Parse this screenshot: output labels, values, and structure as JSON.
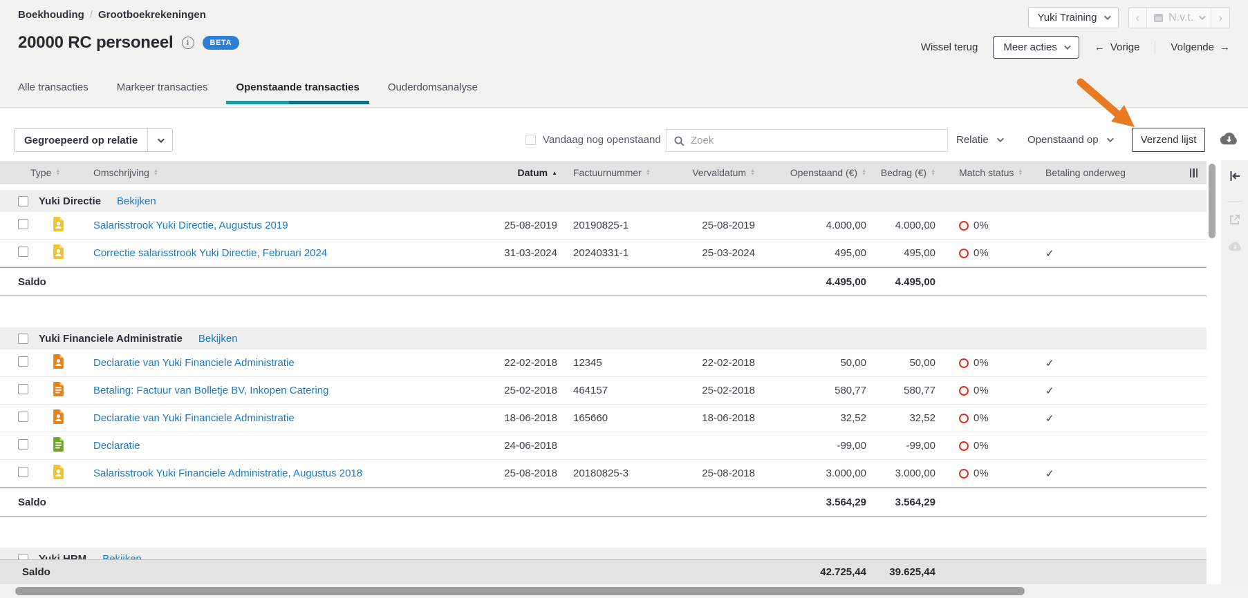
{
  "breadcrumb": {
    "items": [
      "Boekhouding",
      "Grootboekrekeningen"
    ],
    "separator": "/"
  },
  "header": {
    "title": "20000 RC personeel",
    "beta_label": "BETA"
  },
  "topbar": {
    "administration_name": "Yuki Training",
    "period_label": "N.v.t.",
    "wissel_terug": "Wissel terug",
    "meer_acties": "Meer acties",
    "vorige": "Vorige",
    "volgende": "Volgende"
  },
  "tabs": [
    {
      "label": "Alle transacties",
      "active": false
    },
    {
      "label": "Markeer transacties",
      "active": false
    },
    {
      "label": "Openstaande transacties",
      "active": true
    },
    {
      "label": "Ouderdomsanalyse",
      "active": false
    }
  ],
  "filterbar": {
    "group_select_label": "Gegroepeerd op relatie",
    "today_checkbox_label": "Vandaag nog openstaand",
    "search_placeholder": "Zoek",
    "relatie_label": "Relatie",
    "openstaand_op_label": "Openstaand op",
    "verzend_lijst_label": "Verzend lijst"
  },
  "table": {
    "columns": [
      "Type",
      "Omschrijving",
      "Datum",
      "Factuurnummer",
      "Vervaldatum",
      "Openstaand (€)",
      "Bedrag (€)",
      "Match status",
      "Betaling onderweg"
    ],
    "sorted_column": "Datum",
    "groups": [
      {
        "name": "Yuki Directie",
        "view_link": "Bekijken",
        "saldo_label": "Saldo",
        "saldo": {
          "openstaand": "4.495,00",
          "bedrag": "4.495,00"
        },
        "rows": [
          {
            "icon": {
              "name": "salarisstrook-doc-icon",
              "color": "#f0c330",
              "glyph": "person"
            },
            "omschrijving": "Salarisstrook Yuki Directie, Augustus 2019",
            "datum": "25-08-2019",
            "factuurnummer": "20190825-1",
            "vervaldatum": "25-08-2019",
            "openstaand": "4.000,00",
            "bedrag": "4.000,00",
            "match_status": "0%",
            "betaling_onderweg": false
          },
          {
            "icon": {
              "name": "salarisstrook-doc-icon",
              "color": "#f0c330",
              "glyph": "person"
            },
            "omschrijving": "Correctie salarisstrook Yuki Directie, Februari 2024",
            "datum": "31-03-2024",
            "factuurnummer": "20240331-1",
            "vervaldatum": "25-03-2024",
            "openstaand": "495,00",
            "bedrag": "495,00",
            "match_status": "0%",
            "betaling_onderweg": true
          }
        ]
      },
      {
        "name": "Yuki Financiele Administratie",
        "view_link": "Bekijken",
        "saldo_label": "Saldo",
        "saldo": {
          "openstaand": "3.564,29",
          "bedrag": "3.564,29"
        },
        "rows": [
          {
            "icon": {
              "name": "declaratie-doc-icon",
              "color": "#ee7f11",
              "glyph": "person"
            },
            "omschrijving": "Declaratie van Yuki Financiele Administratie",
            "datum": "22-02-2018",
            "factuurnummer": "12345",
            "vervaldatum": "22-02-2018",
            "openstaand": "50,00",
            "bedrag": "50,00",
            "match_status": "0%",
            "betaling_onderweg": true
          },
          {
            "icon": {
              "name": "factuur-doc-icon",
              "color": "#ee7f11",
              "glyph": "lines"
            },
            "omschrijving": "Betaling: Factuur van Bolletje BV, Inkopen Catering",
            "datum": "25-02-2018",
            "factuurnummer": "464157",
            "vervaldatum": "25-02-2018",
            "openstaand": "580,77",
            "bedrag": "580,77",
            "match_status": "0%",
            "betaling_onderweg": true
          },
          {
            "icon": {
              "name": "declaratie-doc-icon",
              "color": "#ee7f11",
              "glyph": "person"
            },
            "omschrijving": "Declaratie van Yuki Financiele Administratie",
            "datum": "18-06-2018",
            "factuurnummer": "165660",
            "vervaldatum": "18-06-2018",
            "openstaand": "32,52",
            "bedrag": "32,52",
            "match_status": "0%",
            "betaling_onderweg": true
          },
          {
            "icon": {
              "name": "declaratie-doc-icon",
              "color": "#6fa81f",
              "glyph": "lines"
            },
            "omschrijving": "Declaratie",
            "datum": "24-06-2018",
            "factuurnummer": "",
            "vervaldatum": "",
            "openstaand": "-99,00",
            "bedrag": "-99,00",
            "match_status": "0%",
            "betaling_onderweg": false
          },
          {
            "icon": {
              "name": "salarisstrook-doc-icon",
              "color": "#f0c330",
              "glyph": "person"
            },
            "omschrijving": "Salarisstrook Yuki Financiele Administratie, Augustus 2018",
            "datum": "25-08-2018",
            "factuurnummer": "20180825-3",
            "vervaldatum": "25-08-2018",
            "openstaand": "3.000,00",
            "bedrag": "3.000,00",
            "match_status": "0%",
            "betaling_onderweg": true
          }
        ]
      },
      {
        "name": "Yuki HRM",
        "view_link": "Bekijken",
        "saldo_label": "Saldo",
        "saldo": null,
        "rows": []
      }
    ],
    "total": {
      "label": "Saldo",
      "openstaand": "42.725,44",
      "bedrag": "39.625,44"
    }
  },
  "colors": {
    "link_blue": "#1b79c4",
    "beta_badge_blue": "#2e7ed5",
    "active_tab_teal": "#1f96a7",
    "match_ring_red": "#e0301e",
    "annotation_arrow_orange": "#e87a24"
  },
  "annotation": {
    "type": "arrow",
    "target": "Verzend lijst",
    "color": "#e87a24"
  }
}
